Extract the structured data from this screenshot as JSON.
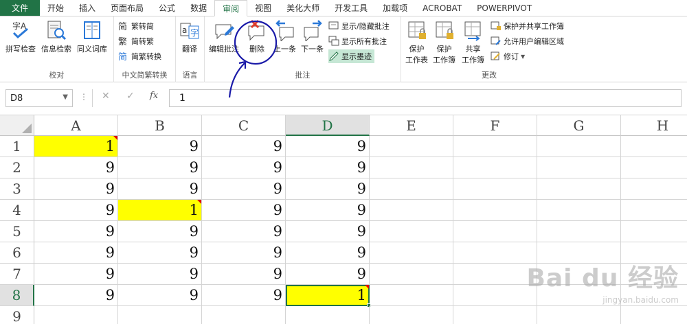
{
  "tabs": [
    "文件",
    "开始",
    "插入",
    "页面布局",
    "公式",
    "数据",
    "审阅",
    "视图",
    "美化大师",
    "开发工具",
    "加载项",
    "ACROBAT",
    "POWERPIVOT"
  ],
  "active_tab_index": 6,
  "ribbon": {
    "proofing": {
      "label": "校对",
      "spell": "拼写检查",
      "research": "信息检索",
      "thesaurus": "同义词库"
    },
    "chinese": {
      "label": "中文简繁转换",
      "to_simplified": "繁转简",
      "to_traditional": "简转繁",
      "convert": "简繁转换"
    },
    "language": {
      "label": "语言",
      "translate": "翻译"
    },
    "comments": {
      "label": "批注",
      "edit": "编辑批注",
      "delete": "删除",
      "previous": "上一条",
      "next": "下一条",
      "show_hide": "显示/隐藏批注",
      "show_all": "显示所有批注",
      "show_ink": "显示墨迹"
    },
    "changes": {
      "label": "更改",
      "protect_sheet_1": "保护",
      "protect_sheet_2": "工作表",
      "protect_wb_1": "保护",
      "protect_wb_2": "工作簿",
      "share_wb_1": "共享",
      "share_wb_2": "工作簿",
      "protect_share": "保护并共享工作簿",
      "allow_edit": "允许用户编辑区域",
      "track": "修订"
    }
  },
  "formula_bar": {
    "name_box": "D8",
    "value": "1",
    "fx": "fx"
  },
  "columns": [
    "A",
    "B",
    "C",
    "D",
    "E",
    "F",
    "G",
    "H"
  ],
  "rows": [
    "1",
    "2",
    "3",
    "4",
    "5",
    "6",
    "7",
    "8",
    "9"
  ],
  "selected_cell": "D8",
  "cells": {
    "A": [
      "1",
      "9",
      "9",
      "9",
      "9",
      "9",
      "9",
      "9"
    ],
    "B": [
      "9",
      "9",
      "9",
      "1",
      "9",
      "9",
      "9",
      "9"
    ],
    "C": [
      "9",
      "9",
      "9",
      "9",
      "9",
      "9",
      "9",
      "9"
    ],
    "D": [
      "9",
      "9",
      "9",
      "9",
      "9",
      "9",
      "9",
      "1"
    ]
  },
  "highlighted_cells": [
    "A1",
    "B4",
    "D8"
  ],
  "comment_cells": [
    "A1",
    "B4",
    "D8"
  ],
  "colors": {
    "accent": "#217346",
    "highlight": "#ffff00",
    "annotation": "#1a1aa8"
  },
  "watermark": {
    "logo": "Bai du 经验",
    "sub": "jingyan.baidu.com"
  }
}
